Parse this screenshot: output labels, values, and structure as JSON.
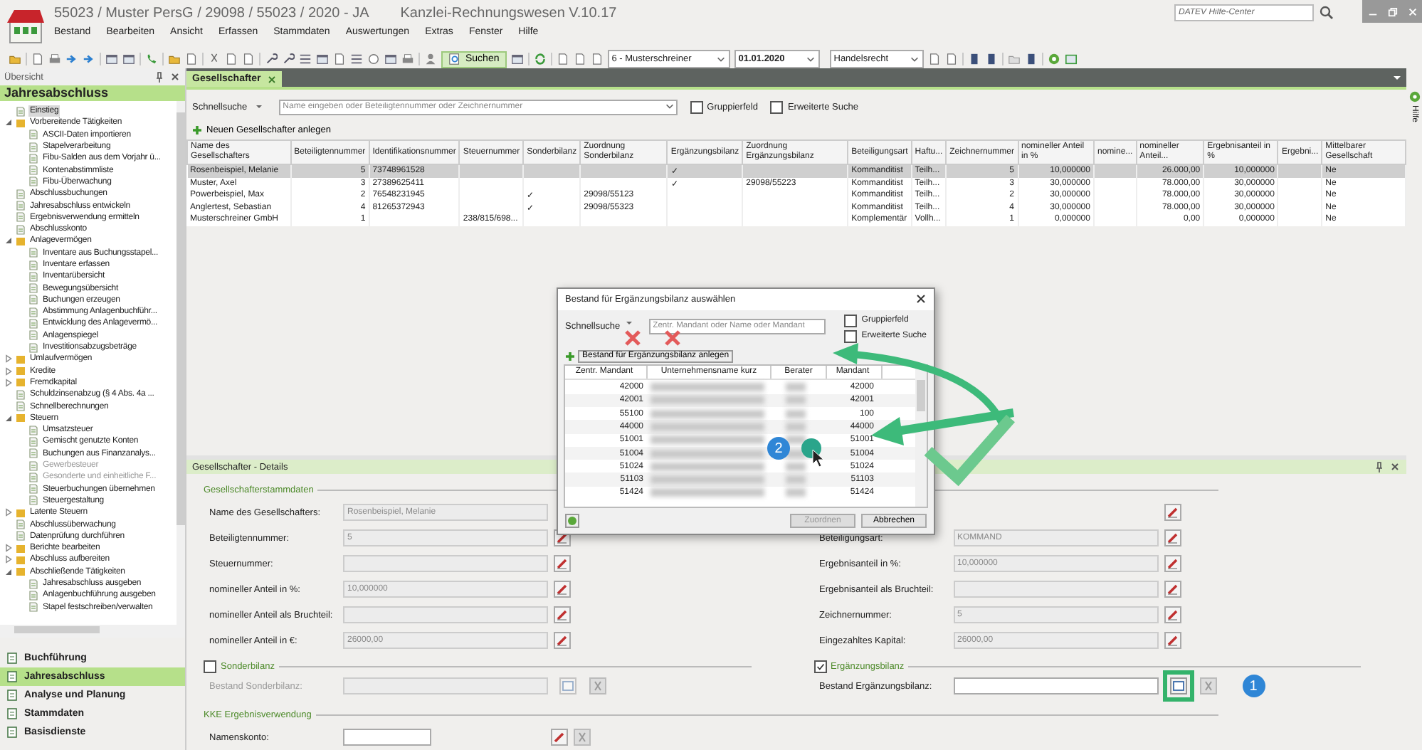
{
  "window": {
    "title": "55023 / Muster PersG / 29098 / 55023 / 2020 - JA",
    "app_name": "Kanzlei-Rechnungswesen V.10.17"
  },
  "help_search": {
    "placeholder": "DATEV Hilfe-Center"
  },
  "menu": [
    "Bestand",
    "Bearbeiten",
    "Ansicht",
    "Erfassen",
    "Stammdaten",
    "Auswertungen",
    "Extras",
    "Fenster",
    "Hilfe"
  ],
  "toolbar": {
    "search_button": "Suchen",
    "selects": [
      "6 - Musterschreiner",
      "01.01.2020",
      "Handelsrecht"
    ]
  },
  "sidebar": {
    "panel_title": "Übersicht",
    "heading": "Jahresabschluss",
    "tree": [
      {
        "label": "Einstieg",
        "kind": "page",
        "selected": true,
        "disabled": false
      },
      {
        "label": "Vorbereitende Tätigkeiten",
        "kind": "folder",
        "expanded": true,
        "selected": false,
        "disabled": false,
        "children": [
          {
            "label": "ASCII-Daten importieren",
            "kind": "page",
            "selected": false,
            "disabled": false
          },
          {
            "label": "Stapelverarbeitung",
            "kind": "page",
            "selected": false,
            "disabled": false
          },
          {
            "label": "Fibu-Salden aus dem Vorjahr ü...",
            "kind": "page",
            "selected": false,
            "disabled": false
          },
          {
            "label": "Kontenabstimmliste",
            "kind": "page",
            "selected": false,
            "disabled": false
          },
          {
            "label": "Fibu-Überwachung",
            "kind": "page",
            "selected": false,
            "disabled": false
          }
        ]
      },
      {
        "label": "Abschlussbuchungen",
        "kind": "page",
        "selected": false,
        "disabled": false
      },
      {
        "label": "Jahresabschluss entwickeln",
        "kind": "page",
        "selected": false,
        "disabled": false
      },
      {
        "label": "Ergebnisverwendung ermitteln",
        "kind": "page",
        "selected": false,
        "disabled": false
      },
      {
        "label": "Abschlusskonto",
        "kind": "page",
        "selected": false,
        "disabled": false
      },
      {
        "label": "Anlagevermögen",
        "kind": "folder",
        "expanded": true,
        "selected": false,
        "disabled": false,
        "children": [
          {
            "label": "Inventare aus Buchungsstapel...",
            "kind": "page",
            "selected": false,
            "disabled": false
          },
          {
            "label": "Inventare erfassen",
            "kind": "page",
            "selected": false,
            "disabled": false
          },
          {
            "label": "Inventarübersicht",
            "kind": "page",
            "selected": false,
            "disabled": false
          },
          {
            "label": "Bewegungsübersicht",
            "kind": "page",
            "selected": false,
            "disabled": false
          },
          {
            "label": "Buchungen erzeugen",
            "kind": "page",
            "selected": false,
            "disabled": false
          },
          {
            "label": "Abstimmung Anlagenbuchführ...",
            "kind": "page",
            "selected": false,
            "disabled": false
          },
          {
            "label": "Entwicklung des Anlagevermö...",
            "kind": "page",
            "selected": false,
            "disabled": false
          },
          {
            "label": "Anlagenspiegel",
            "kind": "page",
            "selected": false,
            "disabled": false
          },
          {
            "label": "Investitionsabzugsbeträge",
            "kind": "page",
            "selected": false,
            "disabled": false
          }
        ]
      },
      {
        "label": "Umlaufvermögen",
        "kind": "folder",
        "expanded": false,
        "selected": false,
        "disabled": false
      },
      {
        "label": "Kredite",
        "kind": "folder",
        "expanded": false,
        "selected": false,
        "disabled": false
      },
      {
        "label": "Fremdkapital",
        "kind": "folder",
        "expanded": false,
        "selected": false,
        "disabled": false
      },
      {
        "label": "Schuldzinsenabzug (§ 4 Abs. 4a ...",
        "kind": "page",
        "selected": false,
        "disabled": false
      },
      {
        "label": "Schnellberechnungen",
        "kind": "page",
        "selected": false,
        "disabled": false
      },
      {
        "label": "Steuern",
        "kind": "folder",
        "expanded": true,
        "selected": false,
        "disabled": false,
        "children": [
          {
            "label": "Umsatzsteuer",
            "kind": "page",
            "selected": false,
            "disabled": false
          },
          {
            "label": "Gemischt genutzte Konten",
            "kind": "page",
            "selected": false,
            "disabled": false
          },
          {
            "label": "Buchungen aus Finanzanalys...",
            "kind": "page",
            "selected": false,
            "disabled": false
          },
          {
            "label": "Gewerbesteuer",
            "kind": "page",
            "selected": false,
            "disabled": true
          },
          {
            "label": "Gesonderte und einheitliche F...",
            "kind": "page",
            "selected": false,
            "disabled": true
          },
          {
            "label": "Steuerbuchungen übernehmen",
            "kind": "page",
            "selected": false,
            "disabled": false
          },
          {
            "label": "Steuergestaltung",
            "kind": "page",
            "selected": false,
            "disabled": false
          }
        ]
      },
      {
        "label": "Latente Steuern",
        "kind": "folder",
        "expanded": false,
        "selected": false,
        "disabled": false
      },
      {
        "label": "Abschlussüberwachung",
        "kind": "page",
        "selected": false,
        "disabled": false
      },
      {
        "label": "Datenprüfung durchführen",
        "kind": "page",
        "selected": false,
        "disabled": false
      },
      {
        "label": "Berichte bearbeiten",
        "kind": "folder",
        "expanded": false,
        "selected": false,
        "disabled": false
      },
      {
        "label": "Abschluss aufbereiten",
        "kind": "folder",
        "expanded": false,
        "selected": false,
        "disabled": false
      },
      {
        "label": "Abschließende Tätigkeiten",
        "kind": "folder",
        "expanded": true,
        "selected": false,
        "disabled": false,
        "children": [
          {
            "label": "Jahresabschluss ausgeben",
            "kind": "page",
            "selected": false,
            "disabled": false
          },
          {
            "label": "Anlagenbuchführung ausgeben",
            "kind": "page",
            "selected": false,
            "disabled": false
          },
          {
            "label": "Stapel festschreiben/verwalten",
            "kind": "page",
            "selected": false,
            "disabled": false
          }
        ]
      }
    ],
    "nav": [
      {
        "label": "Buchführung",
        "selected": false
      },
      {
        "label": "Jahresabschluss",
        "selected": true
      },
      {
        "label": "Analyse und Planung",
        "selected": false
      },
      {
        "label": "Stammdaten",
        "selected": false
      },
      {
        "label": "Basisdienste",
        "selected": false
      }
    ]
  },
  "tabs": [
    {
      "label": "Gesellschafter",
      "selected": true
    }
  ],
  "help_panel": {
    "label": "Hilfe"
  },
  "list": {
    "quick_search_label": "Schnellsuche",
    "search": {
      "placeholder": "Name eingeben oder Beteiligtennummer oder Zeichnernummer"
    },
    "options": [
      {
        "label": "Gruppierfeld",
        "checked": false
      },
      {
        "label": "Erweiterte Suche",
        "checked": false
      }
    ],
    "new_button": "Neuen Gesellschafter anlegen",
    "columns": [
      "Name des Gesellschafters",
      "Beteiligtennummer",
      "Identifikationsnummer",
      "Steuernummer",
      "Sonderbilanz",
      "Zuordnung Sonderbilanz",
      "Ergänzungsbilanz",
      "Zuordnung Ergänzungsbilanz",
      "Beteiligungsart",
      "Haftu...",
      "Zeichnernummer",
      "nomineller Anteil in %",
      "nomine...",
      "nomineller Anteil...",
      "Ergebnisanteil in %",
      "Ergebni...",
      "Mittelbarer Gesellschaft"
    ],
    "rows": [
      {
        "selected": true,
        "cells": [
          "Rosenbeispiel, Melanie",
          "5",
          "73748961528",
          "",
          "",
          "",
          "✓",
          "",
          "Kommanditist",
          "Teilh...",
          "5",
          "10,000000",
          "",
          "26.000,00",
          "10,000000",
          "",
          "Ne"
        ]
      },
      {
        "selected": false,
        "cells": [
          "Muster, Axel",
          "3",
          "27389625411",
          "",
          "",
          "",
          "✓",
          "29098/55223",
          "Kommanditist",
          "Teilh...",
          "3",
          "30,000000",
          "",
          "78.000,00",
          "30,000000",
          "",
          "Ne"
        ]
      },
      {
        "selected": false,
        "cells": [
          "Powerbeispiel, Max",
          "2",
          "76548231945",
          "",
          "✓",
          "29098/55123",
          "",
          "",
          "Kommanditist",
          "Teilh...",
          "2",
          "30,000000",
          "",
          "78.000,00",
          "30,000000",
          "",
          "Ne"
        ]
      },
      {
        "selected": false,
        "cells": [
          "Anglertest, Sebastian",
          "4",
          "81265372943",
          "",
          "✓",
          "29098/55323",
          "",
          "",
          "Kommanditist",
          "Teilh...",
          "4",
          "30,000000",
          "",
          "78.000,00",
          "30,000000",
          "",
          "Ne"
        ]
      },
      {
        "selected": false,
        "cells": [
          "Musterschreiner GmbH",
          "1",
          "",
          "238/815/698...",
          "",
          "",
          "",
          "",
          "Komplementär",
          "Vollh...",
          "1",
          "0,000000",
          "",
          "0,00",
          "0,000000",
          "",
          "Ne"
        ]
      }
    ]
  },
  "details": {
    "title": "Gesellschafter - Details",
    "master_group": "Gesellschafterstammdaten",
    "left_fields": [
      {
        "label": "Name des Gesellschafters:",
        "value": "Rosenbeispiel, Melanie",
        "edit_button": false
      },
      {
        "label": "Beteiligtennummer:",
        "value": "5",
        "edit_button": true
      },
      {
        "label": "Steuernummer:",
        "edit_button": true
      },
      {
        "label": "nomineller Anteil in %:",
        "value": "10,000000",
        "edit_button": true
      },
      {
        "label": "nomineller Anteil als Bruchteil:",
        "edit_button": true
      },
      {
        "label": "nomineller Anteil in €:",
        "value": "26000,00",
        "edit_button": true
      }
    ],
    "right_fields": [
      {
        "label": "Beteiligungsart:",
        "value": "KOMMAND",
        "edit_button": true
      },
      {
        "label": "Ergebnisanteil in %:",
        "value": "10,000000",
        "edit_button": true
      },
      {
        "label": "Ergebnisanteil als Bruchteil:",
        "edit_button": true
      },
      {
        "label": "Zeichnernummer:",
        "value": "5",
        "edit_button": true
      },
      {
        "label": "Eingezahltes Kapital:",
        "value": "26000,00",
        "edit_button": true
      }
    ],
    "balances": [
      {
        "title": "Sonderbilanz",
        "checked": false,
        "field_label": "Bestand Sonderbilanz:",
        "highlighted": false
      },
      {
        "title": "Ergänzungsbilanz",
        "checked": true,
        "field_label": "Bestand Ergänzungsbilanz:",
        "highlighted": true,
        "badge": "1"
      }
    ],
    "kke": {
      "title": "KKE Ergebnisverwendung",
      "field_label": "Namenskonto:"
    }
  },
  "dialog": {
    "title": "Bestand für Ergänzungsbilanz auswählen",
    "quick_search_label": "Schnellsuche",
    "search": {
      "placeholder": "Zentr. Mandant oder Name oder Mandant"
    },
    "options": [
      {
        "label": "Gruppierfeld",
        "checked": false
      },
      {
        "label": "Erweiterte Suche",
        "checked": false
      }
    ],
    "new_button": "Bestand für Ergänzungsbilanz anlegen",
    "columns": [
      "Zentr. Mandant",
      "Unternehmensname kurz",
      "Berater",
      "Mandant"
    ],
    "rows": [
      {
        "central": "42000",
        "client": "42000"
      },
      {
        "central": "42001",
        "client": "42001"
      },
      {
        "central": "55100",
        "client": "100"
      },
      {
        "central": "44000",
        "client": "44000"
      },
      {
        "central": "51001",
        "client": "51001"
      },
      {
        "central": "51004",
        "client": "51004"
      },
      {
        "central": "51024",
        "client": "51024"
      },
      {
        "central": "51103",
        "client": "51103"
      },
      {
        "central": "51424",
        "client": "51424"
      }
    ],
    "badge": "2",
    "buttons": [
      {
        "label": "Zuordnen",
        "disabled": true
      },
      {
        "label": "Abbrechen",
        "disabled": false
      }
    ]
  }
}
